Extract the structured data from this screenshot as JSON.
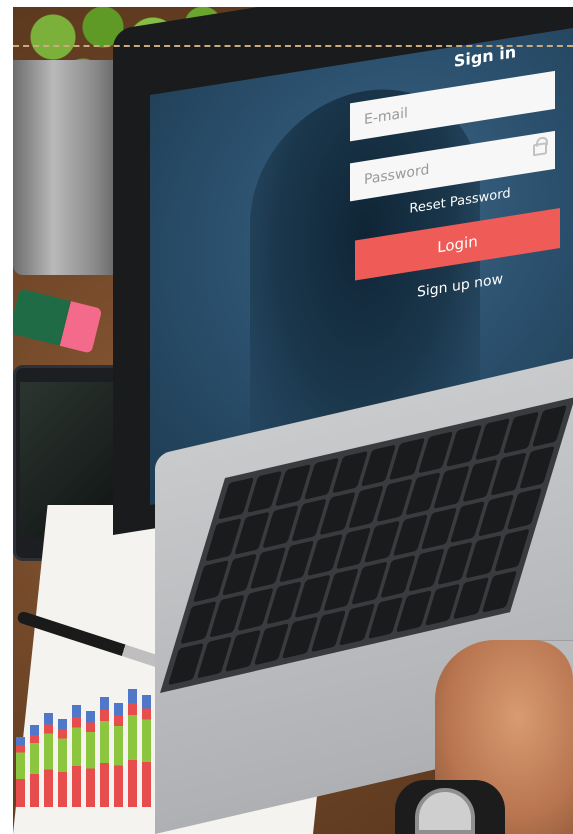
{
  "login_screen": {
    "title": "Sign in",
    "email_placeholder": "E-mail",
    "password_placeholder": "Password",
    "reset_label": "Reset Password",
    "login_label": "Login",
    "signup_label": "Sign up now"
  },
  "colors": {
    "login_button": "#ef5b56",
    "screen_background": "#2c5270",
    "field_background": "#f7f7f7"
  },
  "icons": [
    "lock-icon"
  ]
}
